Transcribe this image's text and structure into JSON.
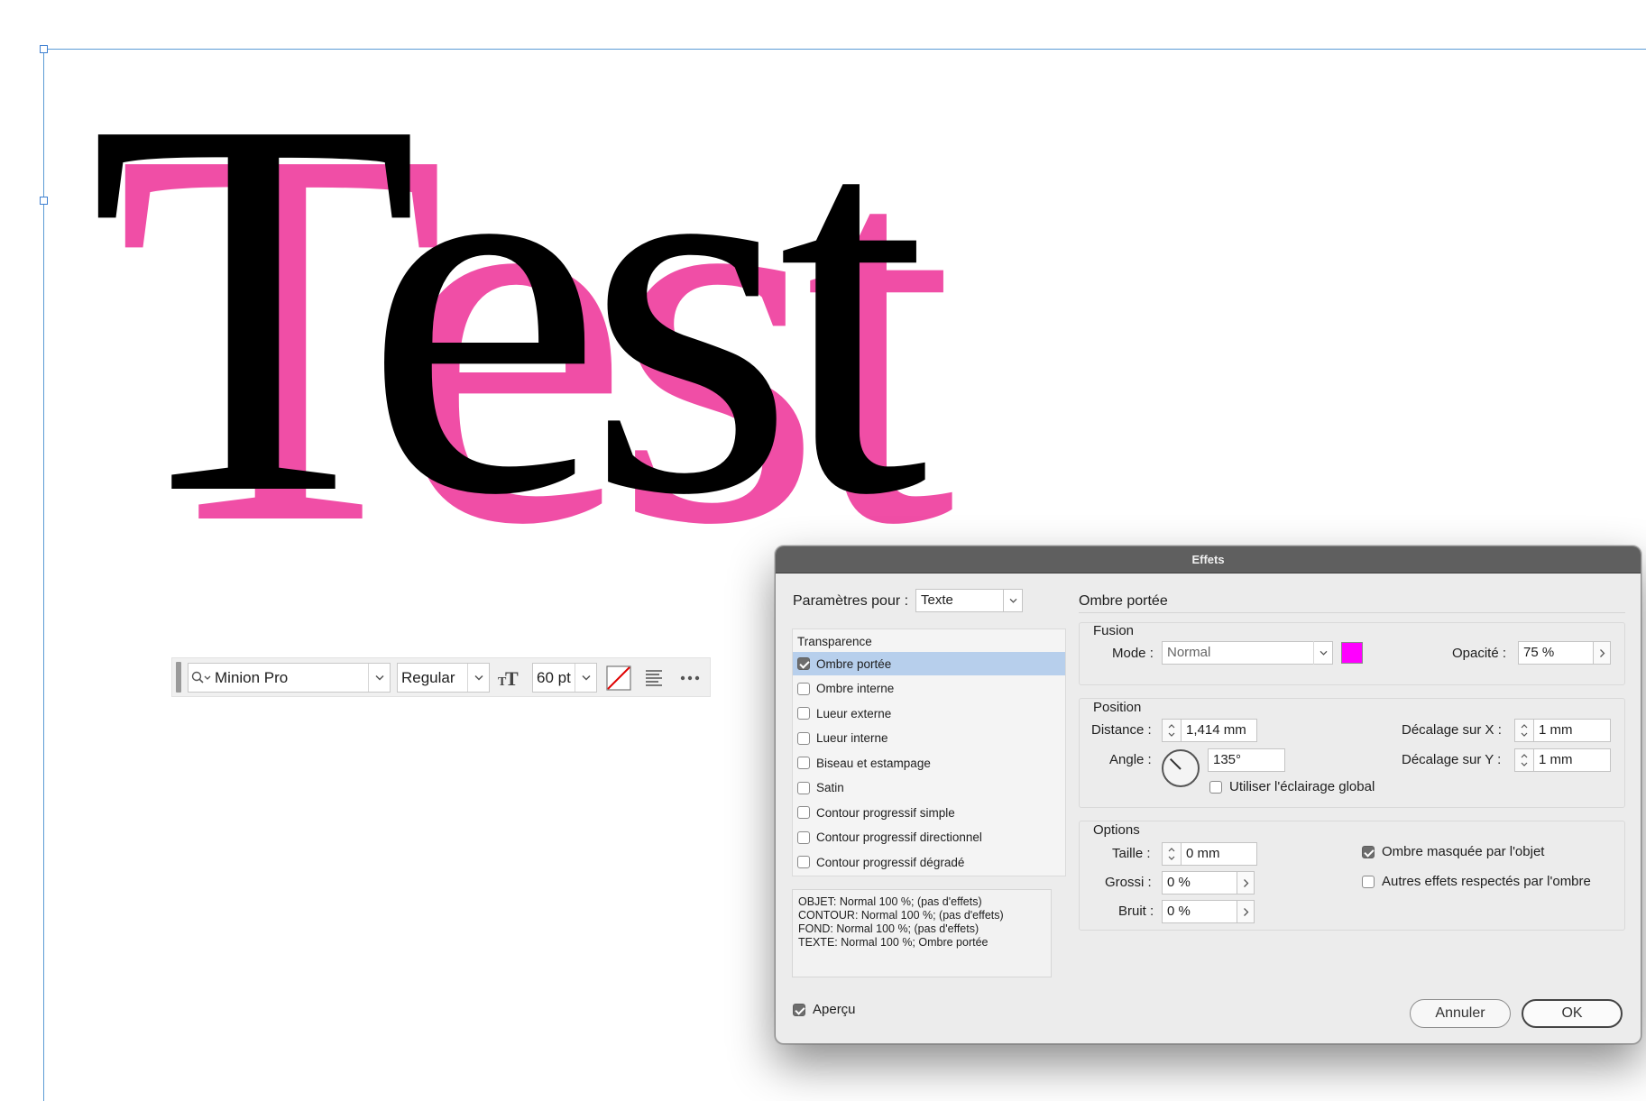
{
  "document": {
    "text_frame_content": "Test",
    "shadow_color": "#f04ea6",
    "text_color": "#000000"
  },
  "control_bar": {
    "font_family": "Minion Pro",
    "font_style": "Regular",
    "font_size": "60 pt",
    "icons": [
      "search-icon",
      "font-size-icon",
      "no-fill-icon",
      "align-left-icon",
      "more-icon"
    ]
  },
  "dialog": {
    "title": "Effets",
    "settings_for_label": "Paramètres pour :",
    "settings_for_value": "Texte",
    "effects_list": {
      "header": "Transparence",
      "items": [
        {
          "label": "Ombre portée",
          "checked": true,
          "selected": true
        },
        {
          "label": "Ombre interne",
          "checked": false,
          "selected": false
        },
        {
          "label": "Lueur externe",
          "checked": false,
          "selected": false
        },
        {
          "label": "Lueur interne",
          "checked": false,
          "selected": false
        },
        {
          "label": "Biseau et estampage",
          "checked": false,
          "selected": false
        },
        {
          "label": "Satin",
          "checked": false,
          "selected": false
        },
        {
          "label": "Contour progressif simple",
          "checked": false,
          "selected": false
        },
        {
          "label": "Contour progressif directionnel",
          "checked": false,
          "selected": false
        },
        {
          "label": "Contour progressif dégradé",
          "checked": false,
          "selected": false
        }
      ]
    },
    "summary_lines": [
      "OBJET: Normal 100 %; (pas d'effets)",
      "CONTOUR: Normal 100 %; (pas d'effets)",
      "FOND: Normal 100 %; (pas d'effets)",
      "TEXTE: Normal 100 %; Ombre portée"
    ],
    "preview": {
      "label": "Aperçu",
      "checked": true
    },
    "section_title": "Ombre portée",
    "fusion": {
      "title": "Fusion",
      "mode_label": "Mode :",
      "mode_value": "Normal",
      "swatch_color": "#ff00ff",
      "opacity_label": "Opacité :",
      "opacity_value": "75 %"
    },
    "position": {
      "title": "Position",
      "distance_label": "Distance :",
      "distance_value": "1,414 mm",
      "angle_label": "Angle :",
      "angle_value": "135°",
      "global_light_label": "Utiliser l'éclairage global",
      "global_light_checked": false,
      "offset_x_label": "Décalage sur X :",
      "offset_x_value": "1 mm",
      "offset_y_label": "Décalage sur Y :",
      "offset_y_value": "1 mm"
    },
    "options": {
      "title": "Options",
      "size_label": "Taille :",
      "size_value": "0 mm",
      "spread_label": "Grossi :",
      "spread_value": "0 %",
      "noise_label": "Bruit :",
      "noise_value": "0 %",
      "knocked_out_label": "Ombre masquée par l'objet",
      "knocked_out_checked": true,
      "honor_effects_label": "Autres effets respectés par l'ombre",
      "honor_effects_checked": false
    },
    "cancel_label": "Annuler",
    "ok_label": "OK"
  }
}
